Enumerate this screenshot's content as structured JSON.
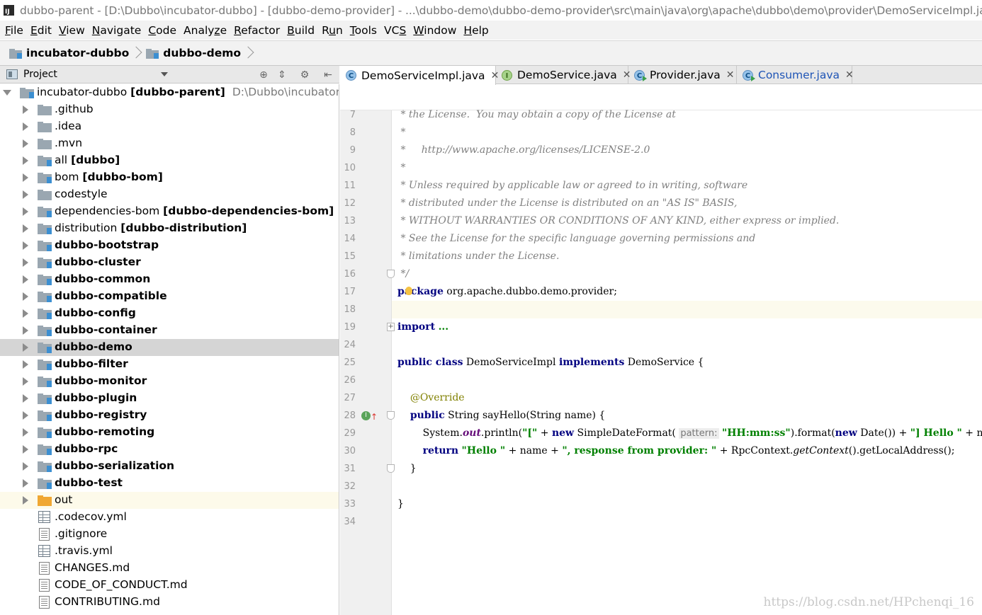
{
  "window": {
    "title": "dubbo-parent - [D:\\Dubbo\\incubator-dubbo] - [dubbo-demo-provider] - ...\\dubbo-demo\\dubbo-demo-provider\\src\\main\\java\\org\\apache\\dubbo\\demo\\provider\\DemoServiceImpl.java"
  },
  "menu": [
    {
      "u": "F",
      "rest": "ile"
    },
    {
      "u": "E",
      "rest": "dit"
    },
    {
      "u": "V",
      "rest": "iew"
    },
    {
      "u": "N",
      "rest": "avigate"
    },
    {
      "u": "C",
      "rest": "ode"
    },
    {
      "pre": "Analy",
      "u": "z",
      "rest": "e"
    },
    {
      "u": "R",
      "rest": "efactor"
    },
    {
      "u": "B",
      "rest": "uild"
    },
    {
      "pre": "R",
      "u": "u",
      "rest": "n"
    },
    {
      "u": "T",
      "rest": "ools"
    },
    {
      "pre": "VC",
      "u": "S",
      "rest": ""
    },
    {
      "u": "W",
      "rest": "indow"
    },
    {
      "u": "H",
      "rest": "elp"
    }
  ],
  "breadcrumb": [
    "incubator-dubbo",
    "dubbo-demo"
  ],
  "project_panel": {
    "label": "Project",
    "root": {
      "name": "incubator-dubbo",
      "module": "[dubbo-parent]",
      "path": "D:\\Dubbo\\incubator-dubbo"
    },
    "items": [
      {
        "name": ".github",
        "bold": false,
        "kind": "folder"
      },
      {
        "name": ".idea",
        "bold": false,
        "kind": "folder"
      },
      {
        "name": ".mvn",
        "bold": false,
        "kind": "folder"
      },
      {
        "name": "all",
        "module": "[dubbo]",
        "bold": false,
        "kind": "module"
      },
      {
        "name": "bom",
        "module": "[dubbo-bom]",
        "bold": false,
        "kind": "module"
      },
      {
        "name": "codestyle",
        "bold": false,
        "kind": "folder"
      },
      {
        "name": "dependencies-bom",
        "module": "[dubbo-dependencies-bom]",
        "bold": false,
        "kind": "module"
      },
      {
        "name": "distribution",
        "module": "[dubbo-distribution]",
        "bold": false,
        "kind": "module"
      },
      {
        "name": "dubbo-bootstrap",
        "bold": true,
        "kind": "module"
      },
      {
        "name": "dubbo-cluster",
        "bold": true,
        "kind": "module"
      },
      {
        "name": "dubbo-common",
        "bold": true,
        "kind": "module"
      },
      {
        "name": "dubbo-compatible",
        "bold": true,
        "kind": "module"
      },
      {
        "name": "dubbo-config",
        "bold": true,
        "kind": "module"
      },
      {
        "name": "dubbo-container",
        "bold": true,
        "kind": "module"
      },
      {
        "name": "dubbo-demo",
        "bold": true,
        "kind": "module",
        "selected": true
      },
      {
        "name": "dubbo-filter",
        "bold": true,
        "kind": "module"
      },
      {
        "name": "dubbo-monitor",
        "bold": true,
        "kind": "module"
      },
      {
        "name": "dubbo-plugin",
        "bold": true,
        "kind": "module"
      },
      {
        "name": "dubbo-registry",
        "bold": true,
        "kind": "module"
      },
      {
        "name": "dubbo-remoting",
        "bold": true,
        "kind": "module"
      },
      {
        "name": "dubbo-rpc",
        "bold": true,
        "kind": "module"
      },
      {
        "name": "dubbo-serialization",
        "bold": true,
        "kind": "module"
      },
      {
        "name": "dubbo-test",
        "bold": true,
        "kind": "module"
      },
      {
        "name": "out",
        "bold": false,
        "kind": "excluded"
      },
      {
        "name": ".codecov.yml",
        "bold": false,
        "kind": "yml"
      },
      {
        "name": ".gitignore",
        "bold": false,
        "kind": "file"
      },
      {
        "name": ".travis.yml",
        "bold": false,
        "kind": "yml"
      },
      {
        "name": "CHANGES.md",
        "bold": false,
        "kind": "file"
      },
      {
        "name": "CODE_OF_CONDUCT.md",
        "bold": false,
        "kind": "file"
      },
      {
        "name": "CONTRIBUTING.md",
        "bold": false,
        "kind": "file"
      }
    ]
  },
  "tabs": [
    {
      "label": "DemoServiceImpl.java",
      "icon": "class",
      "active": true
    },
    {
      "label": "DemoService.java",
      "icon": "interface",
      "active": false
    },
    {
      "label": "Provider.java",
      "icon": "class-run",
      "active": false
    },
    {
      "label": "Consumer.java",
      "icon": "class-run",
      "active": false,
      "blue": true
    }
  ],
  "code": {
    "lines": [
      {
        "n": "7",
        "html": "<span class=\"cm\"> * the License.  You may obtain a copy of the License at</span>"
      },
      {
        "n": "8",
        "html": "<span class=\"cm\"> *</span>"
      },
      {
        "n": "9",
        "html": "<span class=\"cm\"> *     http://www.apache.org/licenses/LICENSE-2.0</span>"
      },
      {
        "n": "10",
        "html": "<span class=\"cm\"> *</span>"
      },
      {
        "n": "11",
        "html": "<span class=\"cm\"> * Unless required by applicable law or agreed to in writing, software</span>"
      },
      {
        "n": "12",
        "html": "<span class=\"cm\"> * distributed under the License is distributed on an \"AS IS\" BASIS,</span>"
      },
      {
        "n": "13",
        "html": "<span class=\"cm\"> * WITHOUT WARRANTIES OR CONDITIONS OF ANY KIND, either express or implied.</span>"
      },
      {
        "n": "14",
        "html": "<span class=\"cm\"> * See the License for the specific language governing permissions and</span>"
      },
      {
        "n": "15",
        "html": "<span class=\"cm\"> * limitations under the License.</span>"
      },
      {
        "n": "16",
        "html": "<span class=\"cm\"> */</span>",
        "fold": "tri"
      },
      {
        "n": "17",
        "html": "<span class=\"kw\">package</span> org.apache.dubbo.demo.provider;",
        "bulb": true
      },
      {
        "n": "18",
        "html": "",
        "hl": true
      },
      {
        "n": "19",
        "html": "<span class=\"kw\">import</span> <span class=\"str\">...</span>",
        "fold": "plus"
      },
      {
        "n": "24",
        "html": ""
      },
      {
        "n": "25",
        "html": "<span class=\"kw\">public class</span> DemoServiceImpl <span class=\"kw\">implements</span> DemoService {"
      },
      {
        "n": "26",
        "html": ""
      },
      {
        "n": "27",
        "html": "    <span class=\"ann\">@Override</span>"
      },
      {
        "n": "28",
        "html": "    <span class=\"kw\">public</span> String sayHello(String name) {",
        "fold": "tri",
        "override": true
      },
      {
        "n": "29",
        "html": "        System.<span class=\"fld\">out</span>.println(<span class=\"str\">\"[\"</span> + <span class=\"kw\">new</span> SimpleDateFormat( <span class=\"hint\">pattern:</span> <span class=\"str\">\"HH:mm:ss\"</span>).format(<span class=\"kw\">new</span> Date()) + <span class=\"str\">\"] Hello \"</span> + name"
      },
      {
        "n": "30",
        "html": "        <span class=\"kw\">return</span> <span class=\"str\">\"Hello \"</span> + name + <span class=\"str\">\", response from provider: \"</span> + RpcContext.<span class=\"it\">getContext</span>().getLocalAddress();"
      },
      {
        "n": "31",
        "html": "    }",
        "fold": "tri"
      },
      {
        "n": "32",
        "html": ""
      },
      {
        "n": "33",
        "html": "}"
      },
      {
        "n": "34",
        "html": ""
      }
    ]
  },
  "watermark": "https://blog.csdn.net/HPchenqi_16"
}
